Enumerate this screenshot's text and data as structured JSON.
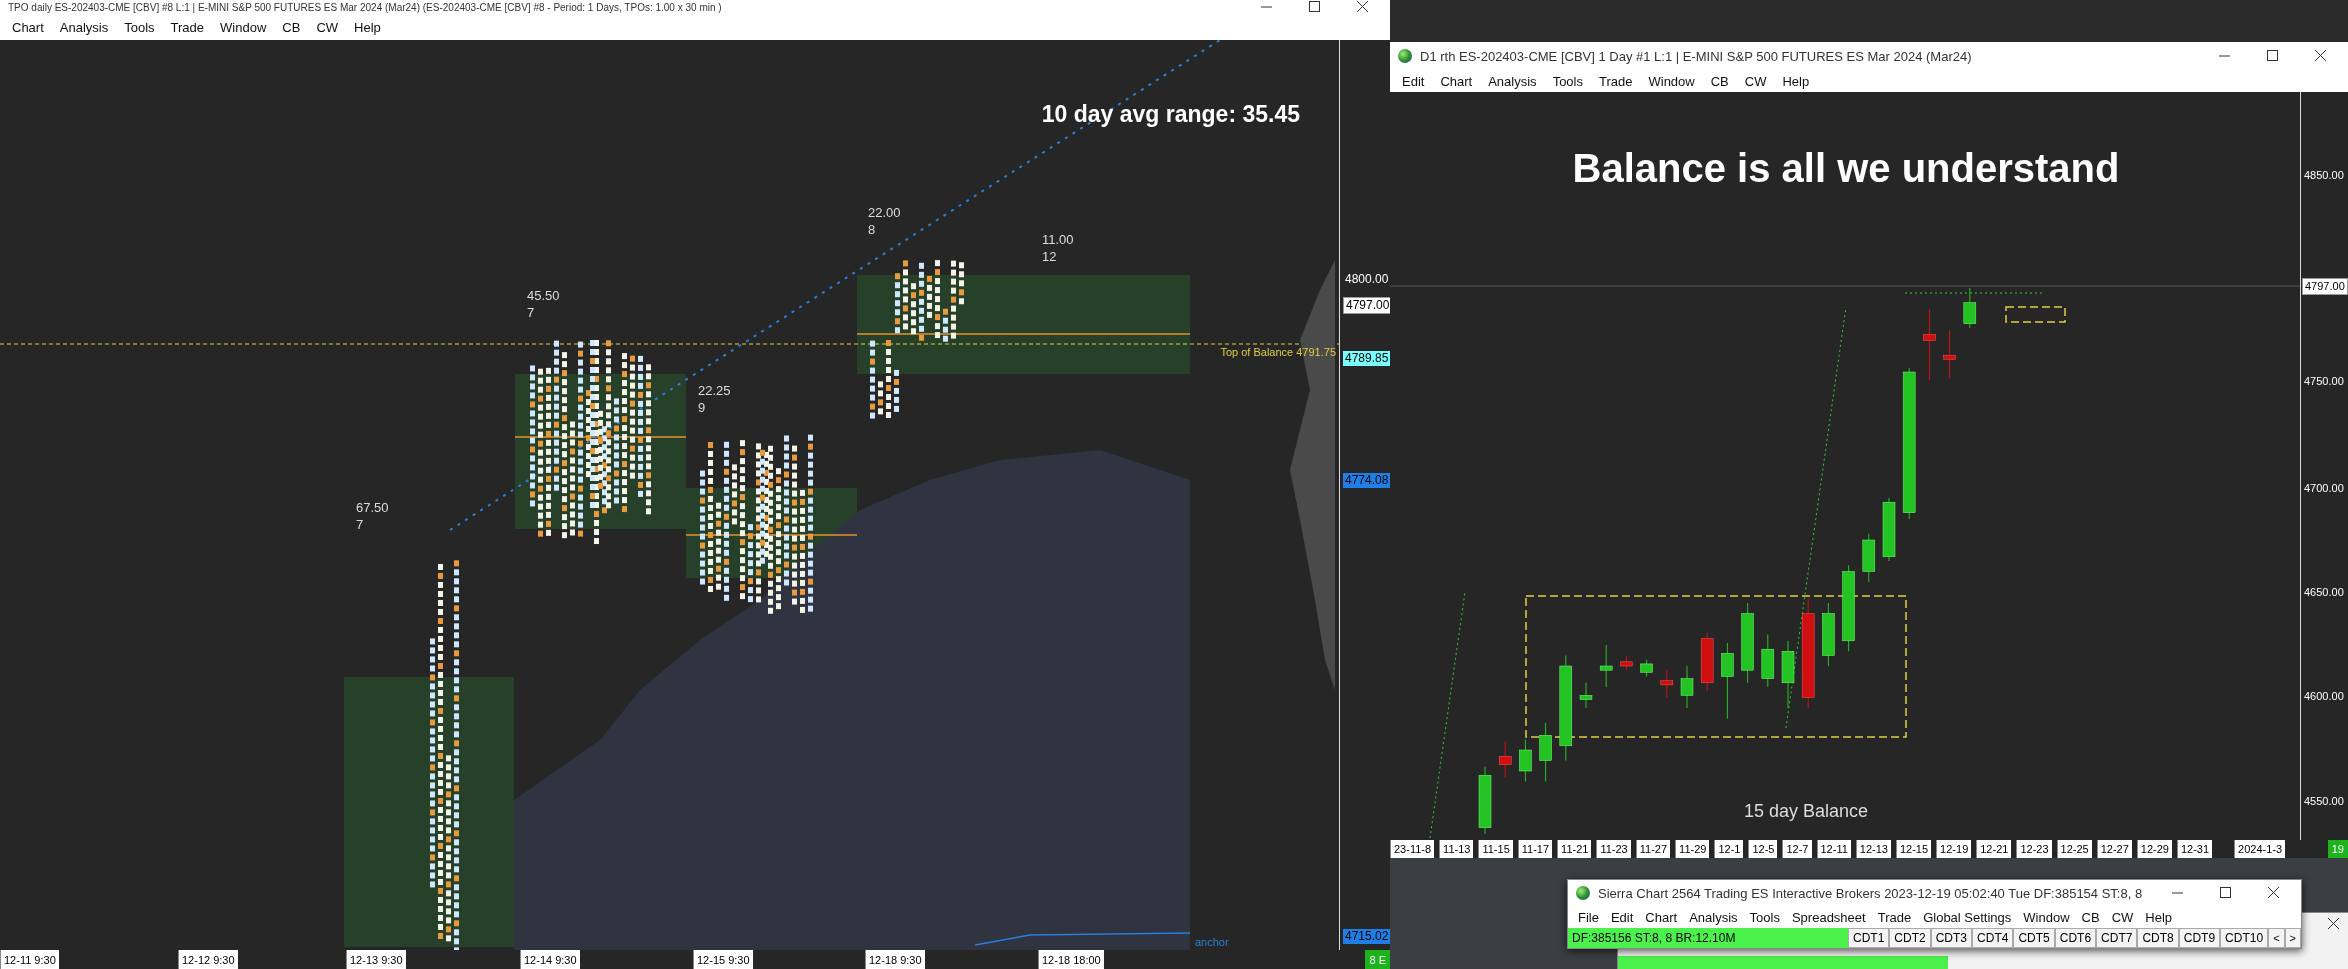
{
  "left_window": {
    "title": "TPO daily ES-202403-CME [CBV] #8 L:1 | E-MINI S&P 500 FUTURES ES Mar 2024 (Mar24) (ES-202403-CME [CBV] #8 - Period: 1 Days, TPOs: 1.00 x 30 min )",
    "menu": [
      "Chart",
      "Analysis",
      "Tools",
      "Trade",
      "Window",
      "CB",
      "CW",
      "Help"
    ],
    "chart": {
      "headline": "10 day avg range:  35.45",
      "profile_labels": [
        {
          "range": "67.50",
          "count": "7"
        },
        {
          "range": "45.50",
          "count": "7"
        },
        {
          "range": "22.25",
          "count": "9"
        },
        {
          "range": "22.00",
          "count": "8"
        },
        {
          "range": "11.00",
          "count": "12"
        }
      ],
      "balance_label": "Top of Balance  4791.75",
      "anchor_label": "anchor"
    },
    "price_axis": [
      {
        "text": "4800.00",
        "kind": "tick"
      },
      {
        "text": "4797.00",
        "kind": "last"
      },
      {
        "text": "4789.85",
        "kind": "cyan"
      },
      {
        "text": "4774.08",
        "kind": "blue"
      },
      {
        "text": "4715.02",
        "kind": "blue"
      }
    ],
    "time_axis": [
      "12-11  9:30",
      "12-12  9:30",
      "12-13  9:30",
      "12-14  9:30",
      "12-15  9:30",
      "12-18  9:30",
      "12-18  18:00"
    ],
    "status_badge": "8 E"
  },
  "right_window": {
    "title": "D1 rth ES-202403-CME [CBV]  1 Day  #1 L:1 | E-MINI S&P 500 FUTURES ES Mar 2024 (Mar24)",
    "menu": [
      "Edit",
      "Chart",
      "Analysis",
      "Tools",
      "Trade",
      "Window",
      "CB",
      "CW",
      "Help"
    ],
    "chart": {
      "headline": "Balance is all we understand",
      "box_label": "15 day Balance"
    },
    "price_axis": [
      {
        "text": "4850.00",
        "kind": "tick"
      },
      {
        "text": "4797.00",
        "kind": "last"
      },
      {
        "text": "4750.00",
        "kind": "tick"
      },
      {
        "text": "4700.00",
        "kind": "tick"
      },
      {
        "text": "4650.00",
        "kind": "tick"
      },
      {
        "text": "4600.00",
        "kind": "tick"
      },
      {
        "text": "4550.00",
        "kind": "tick"
      }
    ],
    "date_axis": [
      "23-11-8",
      "11-13",
      "11-15",
      "11-17",
      "11-21",
      "11-23",
      "11-27",
      "11-29",
      "12-1",
      "12-5",
      "12-7",
      "12-11",
      "12-13",
      "12-15",
      "12-19",
      "12-21",
      "12-23",
      "12-25",
      "12-27",
      "12-29",
      "12-31",
      "2024-1-3"
    ],
    "status_badge": "19"
  },
  "sierra_window": {
    "title": "Sierra Chart 2564 Trading ES Interactive Brokers 2023-12-19  05:02:40 Tue  DF:385154  ST:8, 8",
    "menu": [
      "File",
      "Edit",
      "Chart",
      "Analysis",
      "Tools",
      "Spreadsheet",
      "Trade",
      "Global Settings",
      "Window",
      "CB",
      "CW",
      "Help"
    ],
    "status": "DF:385156  ST:8, 8  BR:12.10M",
    "tabs": [
      "CDT1",
      "CDT2",
      "CDT3",
      "CDT4",
      "CDT5",
      "CDT6",
      "CDT7",
      "CDT8",
      "CDT9",
      "CDT10"
    ],
    "nav": [
      "<",
      ">"
    ]
  }
}
